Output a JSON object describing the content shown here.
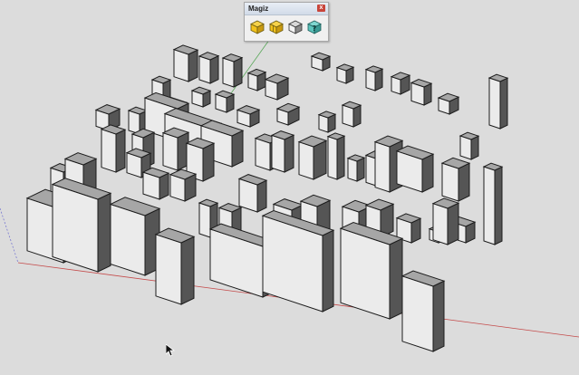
{
  "toolbar": {
    "title": "Magiz",
    "close_label": "x",
    "tools": [
      {
        "icon": "box-yellow-icon"
      },
      {
        "icon": "box-yellow-split-icon"
      },
      {
        "icon": "box-gray-icon"
      },
      {
        "icon": "help-question-icon"
      }
    ]
  },
  "colors": {
    "background": "#dcdcdc",
    "top_face": "#a6a6a6",
    "left_face": "#ebebeb",
    "right_face": "#555555",
    "edges": "#1c1c1c",
    "axis_red": "#c44a4a",
    "axis_green": "#5aa85a",
    "axis_blue": "#7a7ad0"
  }
}
